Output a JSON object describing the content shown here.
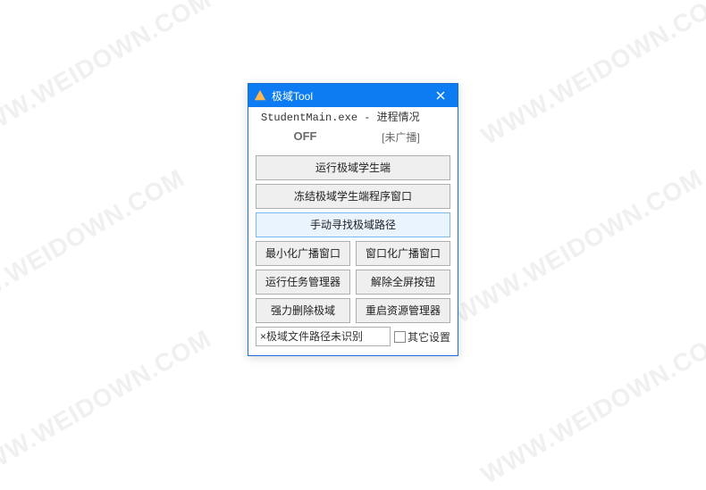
{
  "watermark": "WWW.WEIDOWN.COM",
  "window": {
    "title": "极域Tool",
    "proc_line": "StudentMain.exe - 进程情况",
    "status_off": "OFF",
    "status_broadcast": "[未广播]",
    "btn_run_student": "运行极域学生端",
    "btn_freeze_window": "冻结极域学生端程序窗口",
    "btn_manual_path": "手动寻找极域路径",
    "row1": {
      "left": "最小化广播窗口",
      "right": "窗口化广播窗口"
    },
    "row2": {
      "left": "运行任务管理器",
      "right": "解除全屏按钮"
    },
    "row3": {
      "left": "强力删除极域",
      "right": "重启资源管理器"
    },
    "path_text": "×极域文件路径未识别",
    "checkbox_label": "其它设置"
  }
}
